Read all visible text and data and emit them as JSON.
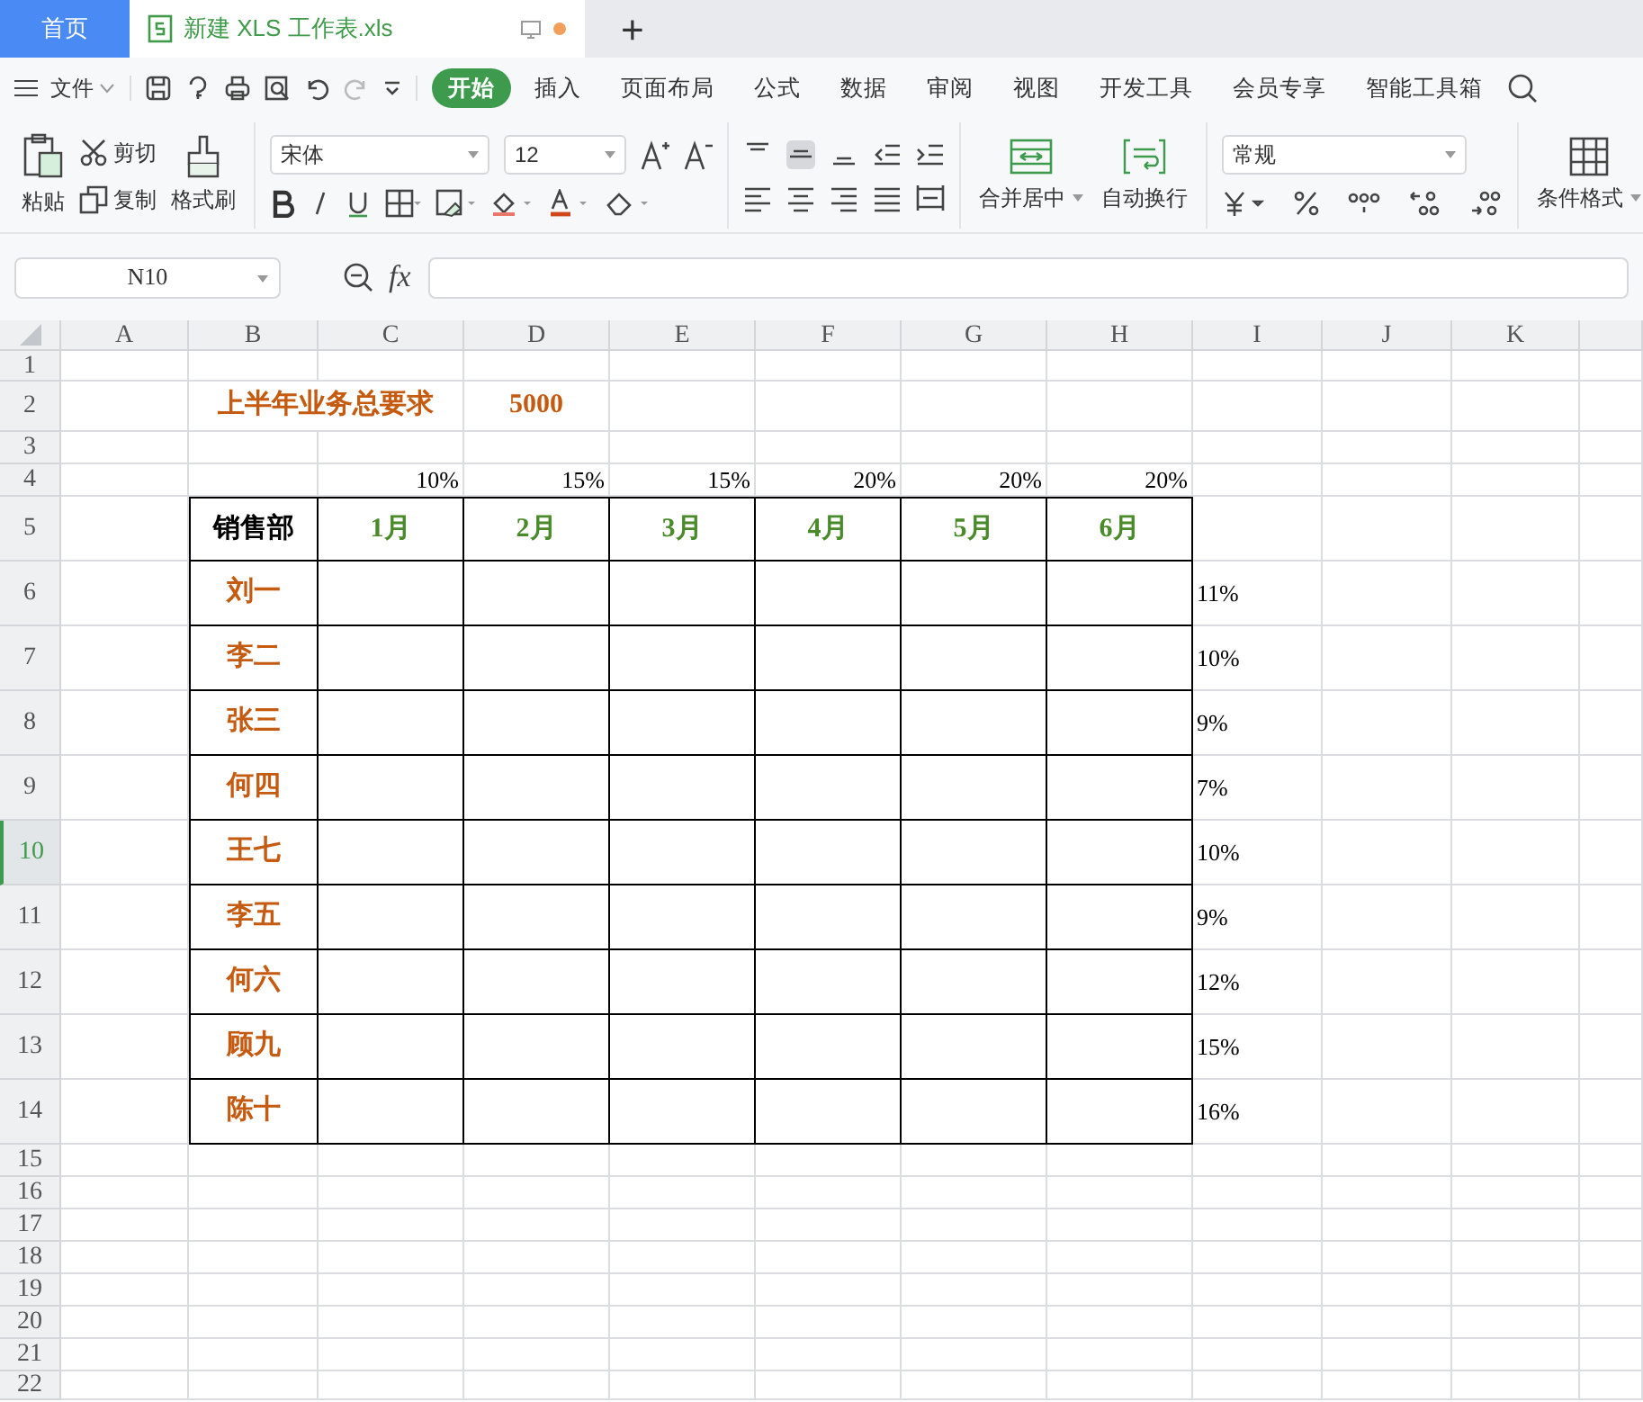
{
  "tabs": [
    {
      "label": "首页",
      "kind": "home",
      "selected": false
    },
    {
      "label": "新建 XLS 工作表.xls",
      "kind": "document",
      "selected": true
    }
  ],
  "new_tab": "+",
  "menu": {
    "file": "文件",
    "tabs": [
      {
        "label": "开始",
        "selected": true
      },
      {
        "label": "插入",
        "selected": false
      },
      {
        "label": "页面布局",
        "selected": false
      },
      {
        "label": "公式",
        "selected": false
      },
      {
        "label": "数据",
        "selected": false
      },
      {
        "label": "审阅",
        "selected": false
      },
      {
        "label": "视图",
        "selected": false
      },
      {
        "label": "开发工具",
        "selected": false
      },
      {
        "label": "会员专享",
        "selected": false
      },
      {
        "label": "智能工具箱",
        "selected": false
      }
    ]
  },
  "ribbon": {
    "paste": "粘贴",
    "cut": "剪切",
    "copy": "复制",
    "format_painter": "格式刷",
    "font": "宋体",
    "font_size": "12",
    "merge": "合并居中",
    "wrap": "自动换行",
    "number_format": "常规",
    "conditional_format": "条件格式"
  },
  "formula_bar": {
    "name_box": "N10",
    "fx": "fx"
  },
  "columns": [
    "A",
    "B",
    "C",
    "D",
    "E",
    "F",
    "G",
    "H",
    "I",
    "J",
    "K"
  ],
  "rows": [
    {
      "label": "1",
      "selected": false
    },
    {
      "label": "2",
      "selected": false
    },
    {
      "label": "3",
      "selected": false
    },
    {
      "label": "4",
      "selected": false
    },
    {
      "label": "5",
      "selected": false
    },
    {
      "label": "6",
      "selected": false
    },
    {
      "label": "7",
      "selected": false
    },
    {
      "label": "8",
      "selected": false
    },
    {
      "label": "9",
      "selected": false
    },
    {
      "label": "10",
      "selected": true
    },
    {
      "label": "11",
      "selected": false
    },
    {
      "label": "12",
      "selected": false
    },
    {
      "label": "13",
      "selected": false
    },
    {
      "label": "14",
      "selected": false
    },
    {
      "label": "15",
      "selected": false
    },
    {
      "label": "16",
      "selected": false
    },
    {
      "label": "17",
      "selected": false
    },
    {
      "label": "18",
      "selected": false
    },
    {
      "label": "19",
      "selected": false
    },
    {
      "label": "20",
      "selected": false
    },
    {
      "label": "21",
      "selected": false
    },
    {
      "label": "22",
      "selected": false
    }
  ],
  "sheet": {
    "target_label": "上半年业务总要求",
    "target_value": "5000",
    "weights": [
      "10%",
      "15%",
      "15%",
      "20%",
      "20%",
      "20%"
    ],
    "corner": "销售部",
    "months": [
      "1月",
      "2月",
      "3月",
      "4月",
      "5月",
      "6月"
    ],
    "people": [
      {
        "name": "刘一",
        "share": "11%"
      },
      {
        "name": "李二",
        "share": "10%"
      },
      {
        "name": "张三",
        "share": "9%"
      },
      {
        "name": "何四",
        "share": "7%"
      },
      {
        "name": "王七",
        "share": "10%"
      },
      {
        "name": "李五",
        "share": "9%"
      },
      {
        "name": "何六",
        "share": "12%"
      },
      {
        "name": "顾九",
        "share": "15%"
      },
      {
        "name": "陈十",
        "share": "16%"
      }
    ]
  }
}
